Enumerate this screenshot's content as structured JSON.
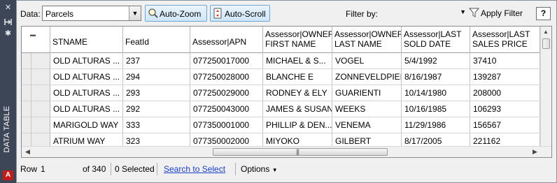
{
  "palette": {
    "title": "DATA TABLE",
    "icons": [
      "close-icon",
      "pin-icon",
      "settings-icon"
    ],
    "brand_icon": "autodesk-logo-icon"
  },
  "toolbar": {
    "data_label": "Data:",
    "data_value": "Parcels",
    "autozoom_label": "Auto-Zoom",
    "autoscroll_label": "Auto-Scroll",
    "filter_label": "Filter by:",
    "filter_value": "",
    "apply_filter_label": "Apply Filter",
    "help_label": "?"
  },
  "table": {
    "columns": [
      "STNAME",
      "FeatId",
      "Assessor|APN",
      "Assessor|OWNER\nFIRST NAME",
      "Assessor|OWNER\nLAST NAME",
      "Assessor|LAST\nSOLD DATE",
      "Assessor|LAST\nSALES PRICE"
    ],
    "rows": [
      [
        "OLD ALTURAS ...",
        "237",
        "077250017000",
        "MICHAEL & S...",
        "VOGEL",
        "5/4/1992",
        "37410"
      ],
      [
        "OLD ALTURAS ...",
        "294",
        "077250028000",
        "BLANCHE E",
        "ZONNEVELDPIEK",
        "8/16/1987",
        "139287"
      ],
      [
        "OLD ALTURAS ...",
        "293",
        "077250029000",
        "RODNEY & ELY",
        "GUARIENTI",
        "10/14/1980",
        "208000"
      ],
      [
        "OLD ALTURAS ...",
        "292",
        "077250043000",
        "JAMES & SUSAN",
        "WEEKS",
        "10/16/1985",
        "106293"
      ],
      [
        "MARIGOLD WAY",
        "333",
        "077350001000",
        "PHILLIP & DEN...",
        "VENEMA",
        "11/29/1986",
        "156567"
      ],
      [
        "ATRIUM WAY",
        "323",
        "077350002000",
        "MIYOKO",
        "GILBERT",
        "8/17/2005",
        "221162"
      ]
    ]
  },
  "status": {
    "row_label": "Row",
    "row_value": "1",
    "of_count": "of 340",
    "selected": "0 Selected",
    "search_link": "Search to Select",
    "options_label": "Options"
  }
}
